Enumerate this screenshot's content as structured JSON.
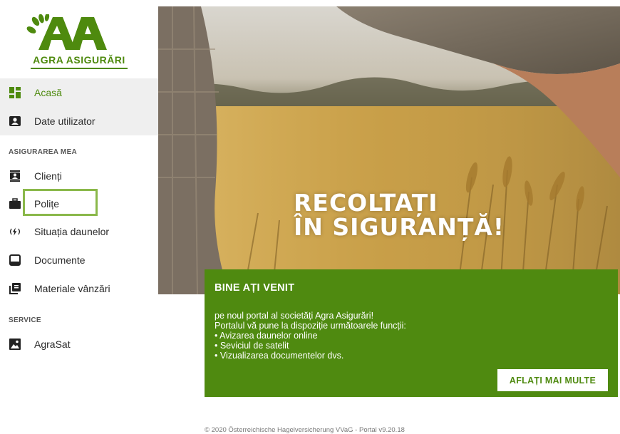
{
  "brand": {
    "name": "AGRA ASIGURĂRI",
    "color": "#4e8a0e"
  },
  "sidebar": {
    "top_items": [
      {
        "label": "Acasă",
        "icon": "dashboard-icon",
        "active": true
      },
      {
        "label": "Date utilizator",
        "icon": "user-card-icon",
        "active": false
      }
    ],
    "sections": [
      {
        "title": "ASIGURAREA MEA",
        "items": [
          {
            "label": "Clienți",
            "icon": "contacts-icon"
          },
          {
            "label": "Polițe",
            "icon": "briefcase-icon"
          },
          {
            "label": "Situația daunelor",
            "icon": "storm-icon"
          },
          {
            "label": "Documente",
            "icon": "document-icon"
          },
          {
            "label": "Materiale vânzări",
            "icon": "library-icon"
          }
        ]
      },
      {
        "title": "SERVICE",
        "items": [
          {
            "label": "AgraSat",
            "icon": "image-icon"
          }
        ]
      }
    ]
  },
  "hero": {
    "line1": "RECOLTAȚI",
    "line2": "ÎN SIGURANȚĂ!"
  },
  "welcome": {
    "title": "BINE AȚI VENIT",
    "lines": [
      "pe noul portal al societăți Agra Asigurări!",
      "Portalul vă pune la dispoziție următoarele funcții:",
      "• Avizarea daunelor online",
      "• Seviciul de satelit",
      "• Vizualizarea documentelor dvs."
    ],
    "button": "AFLAȚI MAI MULTE"
  },
  "footer": "© 2020 Österreichische Hagelversicherung VVaG - Portal v9.20.18"
}
